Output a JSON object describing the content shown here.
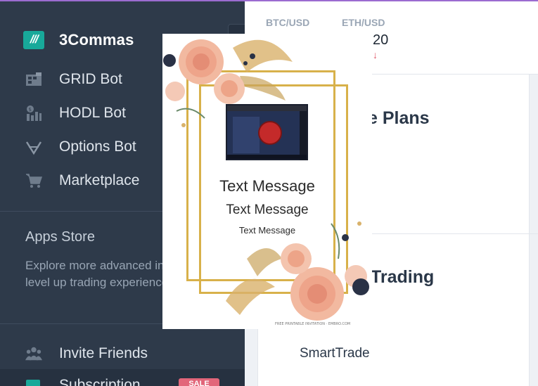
{
  "brand": {
    "name": "3Commas",
    "logo_glyph": "///"
  },
  "sidebar": {
    "items": [
      {
        "label": "GRID Bot",
        "icon": "grid-bot-icon"
      },
      {
        "label": "HODL Bot",
        "icon": "hodl-bot-icon"
      },
      {
        "label": "Options Bot",
        "icon": "options-bot-icon"
      },
      {
        "label": "Marketplace",
        "icon": "cart-icon"
      }
    ],
    "apps_store": {
      "title": "Apps Store",
      "description": "Explore more advanced instruments to level up trading experience"
    },
    "invite": {
      "label": "Invite Friends",
      "icon": "people-icon"
    },
    "subscription": {
      "label": "Subscription",
      "badge": "SALE"
    }
  },
  "tickers": [
    {
      "pair": "BTC/USD",
      "value": "",
      "arrow": ""
    },
    {
      "pair": "ETH/USD",
      "value": "20",
      "arrow": "↓"
    }
  ],
  "main": {
    "section1_heading": "e Plans",
    "section2_heading": "Trading",
    "smarttrade_label": "SmartTrade"
  },
  "overlay": {
    "message_large": "Text Message",
    "message_medium": "Text Message",
    "message_small": "Text Message",
    "credit": "FREE PRINTABLE INVITATION · EMBRO.COM"
  },
  "colors": {
    "sidebar_bg": "#2e3a4a",
    "accent": "#18a99a",
    "sale": "#e2667a",
    "gold": "#d8b14a"
  }
}
